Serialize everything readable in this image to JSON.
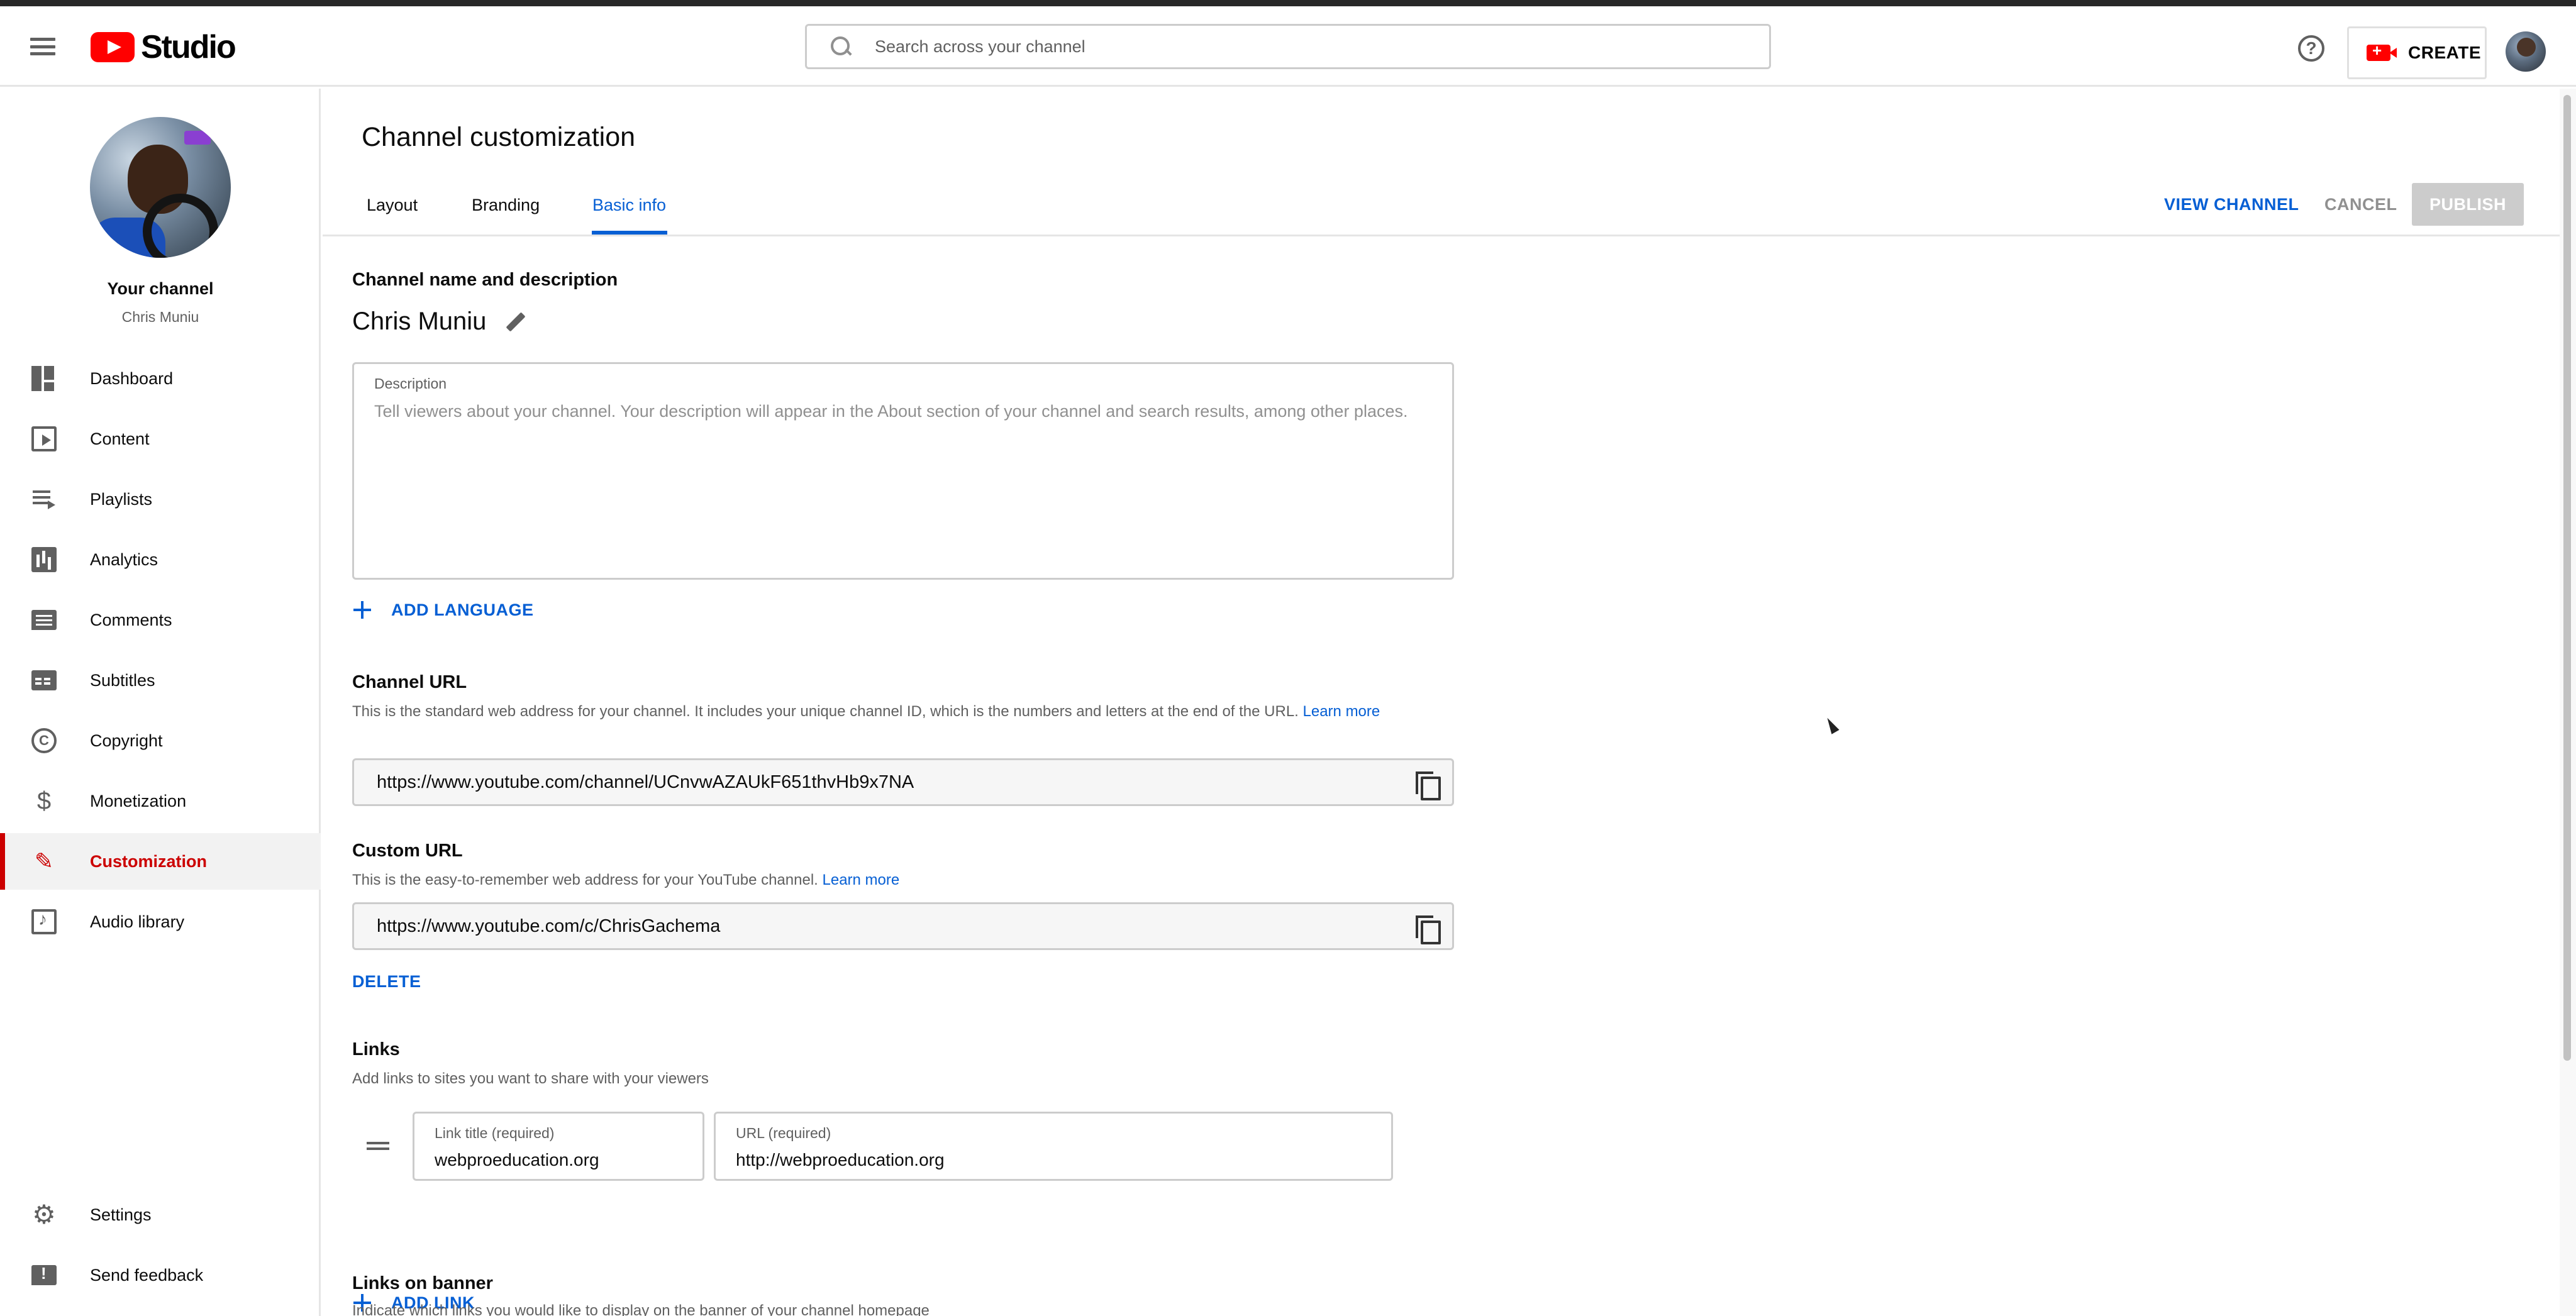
{
  "header": {
    "logo_text": "Studio",
    "search_placeholder": "Search across your channel",
    "create_label": "CREATE",
    "help_glyph": "?"
  },
  "sidebar": {
    "channel_label": "Your channel",
    "channel_owner": "Chris Muniu",
    "items": [
      {
        "label": "Dashboard",
        "icon": "dashboard-icon"
      },
      {
        "label": "Content",
        "icon": "content-icon"
      },
      {
        "label": "Playlists",
        "icon": "playlists-icon"
      },
      {
        "label": "Analytics",
        "icon": "analytics-icon"
      },
      {
        "label": "Comments",
        "icon": "comments-icon"
      },
      {
        "label": "Subtitles",
        "icon": "subtitles-icon"
      },
      {
        "label": "Copyright",
        "icon": "copyright-icon"
      },
      {
        "label": "Monetization",
        "icon": "dollar-icon"
      },
      {
        "label": "Customization",
        "icon": "customization-icon",
        "active": true
      },
      {
        "label": "Audio library",
        "icon": "audio-library-icon"
      }
    ],
    "footer": [
      {
        "label": "Settings",
        "icon": "gear-icon"
      },
      {
        "label": "Send feedback",
        "icon": "feedback-icon"
      }
    ]
  },
  "main": {
    "title": "Channel customization",
    "tabs": [
      "Layout",
      "Branding",
      "Basic info"
    ],
    "active_tab": "Basic info",
    "actions": {
      "view": "VIEW CHANNEL",
      "cancel": "CANCEL",
      "publish": "PUBLISH"
    },
    "name_section": {
      "title": "Channel name and description",
      "channel_name": "Chris Muniu",
      "description_label": "Description",
      "description_placeholder": "Tell viewers about your channel. Your description will appear in the About section of your channel and search results, among other places.",
      "description_value": ""
    },
    "add_language": "ADD LANGUAGE",
    "channel_url": {
      "title": "Channel URL",
      "description": "This is the standard web address for your channel. It includes your unique channel ID, which is the numbers and letters at the end of the URL.",
      "learn_more": "Learn more",
      "value": "https://www.youtube.com/channel/UCnvwAZAUkF651thvHb9x7NA"
    },
    "custom_url": {
      "title": "Custom URL",
      "description": "This is the easy-to-remember web address for your YouTube channel.",
      "learn_more": "Learn more",
      "value": "https://www.youtube.com/c/ChrisGachema",
      "delete": "DELETE"
    },
    "links": {
      "title": "Links",
      "description": "Add links to sites you want to share with your viewers",
      "title_label": "Link title (required)",
      "title_value": "webproeducation.org",
      "url_label": "URL (required)",
      "url_value": "http://webproeducation.org",
      "add_link": "ADD LINK"
    },
    "links_on_banner": {
      "title": "Links on banner",
      "description": "Indicate which links you would like to display on the banner of your channel homepage"
    }
  }
}
